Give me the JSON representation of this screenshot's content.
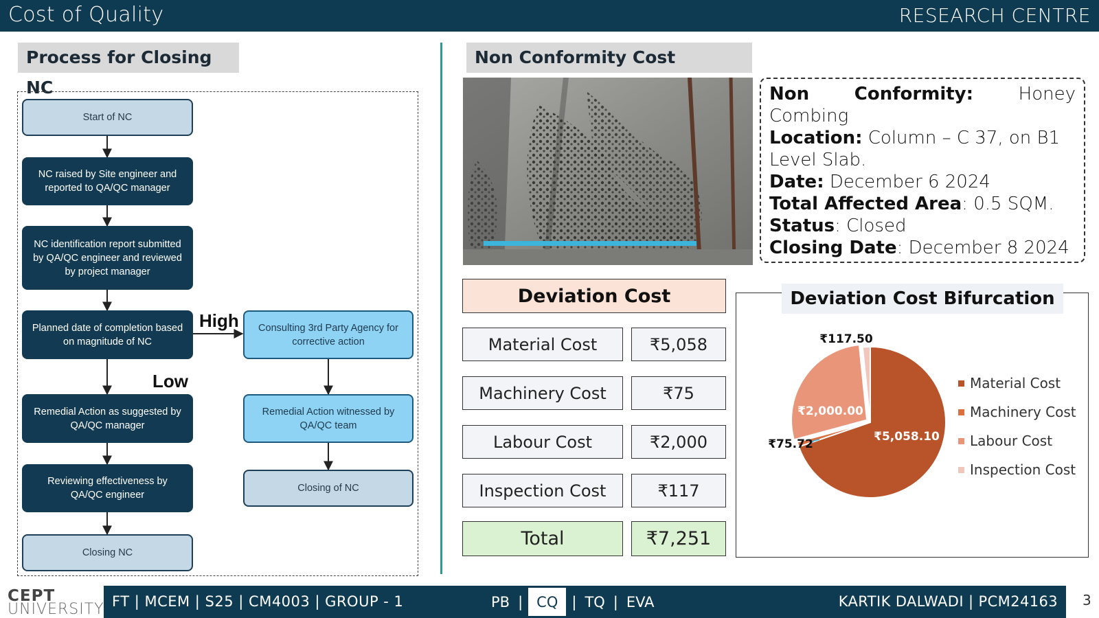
{
  "header": {
    "title": "Cost of Quality",
    "org": "RESEARCH CENTRE"
  },
  "left": {
    "heading": "Process for Closing NC",
    "flow": {
      "start": "Start of NC",
      "raised": "NC raised by Site engineer and reported to QA/QC manager",
      "report": "NC identification report submitted by QA/QC engineer and reviewed by project manager",
      "planned": "Planned date of completion based on magnitude of NC",
      "remedial": "Remedial Action as suggested by QA/QC manager",
      "reviewing": "Reviewing effectiveness by QA/QC engineer",
      "closing": "Closing NC",
      "consulting": "Consulting 3rd Party Agency for corrective action",
      "witnessed": "Remedial Action witnessed by QA/QC team",
      "closing_of": "Closing of NC",
      "high_label": "High",
      "low_label": "Low"
    }
  },
  "right": {
    "heading": "Non Conformity Cost",
    "info": {
      "nc_label": "Non",
      "nc_label2": "Conformity:",
      "nc_value1": "Honey",
      "nc_value2": "Combing",
      "location_label": "Location:",
      "location_value1": "Column – C 37, on B1",
      "location_value2": "Level Slab.",
      "date_label": "Date:",
      "date_value": "December 6 2024",
      "area_label": "Total Affected Area",
      "area_value": ": 0.5 SQM.",
      "status_label": "Status",
      "status_value": ": Closed",
      "closing_label": "Closing Date",
      "closing_value": ": December 8 2024"
    },
    "deviation": {
      "heading": "Deviation Cost",
      "rows": [
        {
          "label": "Material Cost",
          "value": "₹5,058"
        },
        {
          "label": "Machinery Cost",
          "value": "₹75"
        },
        {
          "label": "Labour Cost",
          "value": "₹2,000"
        },
        {
          "label": "Inspection Cost",
          "value": "₹117"
        }
      ],
      "total_label": "Total",
      "total_value": "₹7,251"
    }
  },
  "chart_data": {
    "type": "pie",
    "title": "Deviation Cost Bifurcation",
    "categories": [
      "Material Cost",
      "Machinery Cost",
      "Labour Cost",
      "Inspection Cost"
    ],
    "values": [
      5058.1,
      75.72,
      2000.0,
      117.5
    ],
    "data_labels": [
      "₹5,058.10",
      "₹75.72",
      "₹2,000.00",
      "₹117.50"
    ],
    "colors": [
      "#b8532a",
      "#d9703f",
      "#e8957a",
      "#f1c6bd"
    ],
    "legend": "right"
  },
  "footer": {
    "logo_line1": "CEPT",
    "logo_line2": "UNIVERSITY",
    "left_text": "FT | MCEM | S25 | CM4003 | GROUP - 1",
    "nav": [
      "PB",
      "CQ",
      "TQ",
      "EVA"
    ],
    "active_nav": "CQ",
    "right_text": "KARTIK DALWADI | PCM24163",
    "page_number": "3"
  }
}
